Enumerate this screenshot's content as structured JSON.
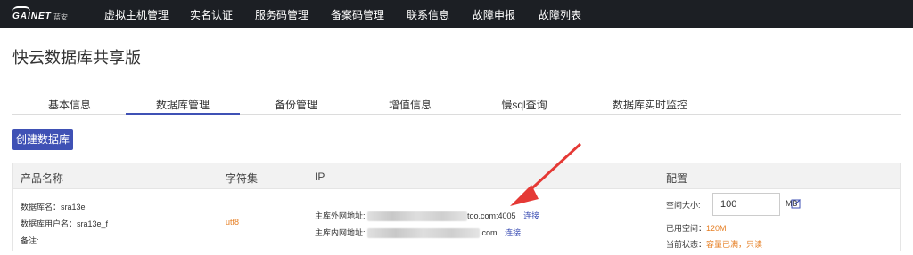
{
  "logo": {
    "brand": "GAINET",
    "brand_cn": "蓝安"
  },
  "nav": [
    "虚拟主机管理",
    "实名认证",
    "服务码管理",
    "备案码管理",
    "联系信息",
    "故障申报",
    "故障列表"
  ],
  "page_title": "快云数据库共享版",
  "tabs": [
    "基本信息",
    "数据库管理",
    "备份管理",
    "增值信息",
    "慢sql查询",
    "数据库实时监控"
  ],
  "active_tab": "数据库管理",
  "create_button": "创建数据库",
  "table": {
    "headers": [
      "产品名称",
      "字符集",
      "IP",
      "配置"
    ],
    "row": {
      "db_name": "数据库名：sra13e",
      "db_user": "数据库用户名：sra13e_f",
      "note": "备注:",
      "charset": "utf8",
      "ext_label": "主库外网地址:",
      "ext_suffix": "too.com:4005",
      "ext_link": "连接",
      "int_label": "主库内网地址:",
      "int_suffix": ".com",
      "int_link": "连接",
      "space_label": "空间大小:",
      "space_value": "100",
      "space_unit": "MB",
      "used_label": "已用空间：",
      "used_value": "120M",
      "status_label": "当前状态：",
      "status_value": "容量已满，只读"
    }
  },
  "colors": {
    "nav_bg": "#1c1f24",
    "accent": "#3f51b5",
    "warning": "#e67e22",
    "arrow": "#e53935"
  }
}
